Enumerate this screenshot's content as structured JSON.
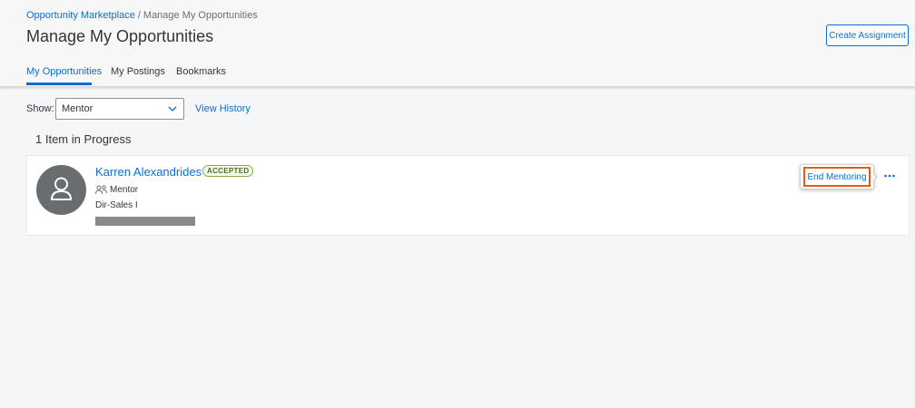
{
  "breadcrumb": {
    "parent": "Opportunity Marketplace",
    "separator": "/",
    "current": "Manage My Opportunities"
  },
  "page": {
    "title": "Manage My Opportunities",
    "create_button": "Create Assignment"
  },
  "tabs": [
    {
      "label": "My Opportunities",
      "active": true
    },
    {
      "label": "My Postings",
      "active": false
    },
    {
      "label": "Bookmarks",
      "active": false
    }
  ],
  "filter": {
    "show_label": "Show:",
    "selected": "Mentor",
    "view_history": "View History"
  },
  "progress_heading": "1 Item in Progress",
  "item": {
    "name": "Karren Alexandrides",
    "status": "ACCEPTED",
    "role": "Mentor",
    "job_title": "Dir-Sales I",
    "action_button": "End Mentoring",
    "icons": {
      "avatar": "person-icon",
      "role": "people-icon",
      "more": "overflow-more-icon"
    }
  },
  "colors": {
    "accent": "#0a6ed1",
    "focus": "#e35c0f",
    "badge_border": "#8aa84d",
    "avatar_bg": "#6a6d70"
  }
}
